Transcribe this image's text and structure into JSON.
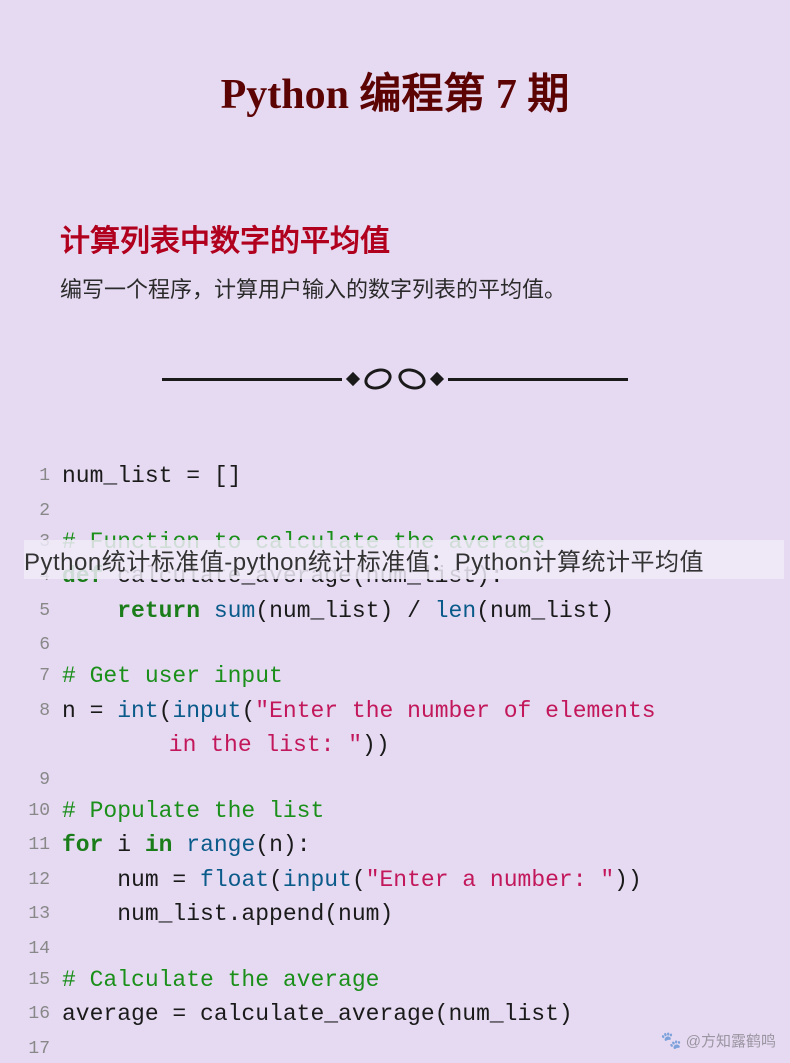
{
  "header": {
    "title": "Python 编程第 7 期"
  },
  "section": {
    "subtitle": "计算列表中数字的平均值",
    "description": "编写一个程序，计算用户输入的数字列表的平均值。"
  },
  "code": {
    "lines": [
      {
        "n": "1",
        "segments": [
          {
            "t": "num_list = []",
            "c": ""
          }
        ]
      },
      {
        "n": "2",
        "segments": []
      },
      {
        "n": "3",
        "segments": [
          {
            "t": "# Function to calculate the average",
            "c": "cmt"
          }
        ]
      },
      {
        "n": "4",
        "segments": [
          {
            "t": "def",
            "c": "kw"
          },
          {
            "t": " calculate_average(num_list):",
            "c": ""
          }
        ]
      },
      {
        "n": "5",
        "segments": [
          {
            "t": "    ",
            "c": ""
          },
          {
            "t": "return",
            "c": "kw"
          },
          {
            "t": " ",
            "c": ""
          },
          {
            "t": "sum",
            "c": "bi"
          },
          {
            "t": "(num_list) / ",
            "c": ""
          },
          {
            "t": "len",
            "c": "bi"
          },
          {
            "t": "(num_list)",
            "c": ""
          }
        ]
      },
      {
        "n": "6",
        "segments": []
      },
      {
        "n": "7",
        "segments": [
          {
            "t": "# Get user input",
            "c": "cmt"
          }
        ]
      },
      {
        "n": "8",
        "segments": [
          {
            "t": "n = ",
            "c": ""
          },
          {
            "t": "int",
            "c": "bi"
          },
          {
            "t": "(",
            "c": ""
          },
          {
            "t": "input",
            "c": "bi"
          },
          {
            "t": "(",
            "c": ""
          },
          {
            "t": "\"Enter the number of elements",
            "c": "str"
          }
        ]
      },
      {
        "n": "",
        "wrapped": true,
        "segments": [
          {
            "t": " in the list: \"",
            "c": "str"
          },
          {
            "t": "))",
            "c": ""
          }
        ]
      },
      {
        "n": "9",
        "segments": []
      },
      {
        "n": "10",
        "segments": [
          {
            "t": "# Populate the list",
            "c": "cmt"
          }
        ]
      },
      {
        "n": "11",
        "segments": [
          {
            "t": "for",
            "c": "kw"
          },
          {
            "t": " i ",
            "c": ""
          },
          {
            "t": "in",
            "c": "kw"
          },
          {
            "t": " ",
            "c": ""
          },
          {
            "t": "range",
            "c": "bi"
          },
          {
            "t": "(n):",
            "c": ""
          }
        ]
      },
      {
        "n": "12",
        "segments": [
          {
            "t": "    num = ",
            "c": ""
          },
          {
            "t": "float",
            "c": "bi"
          },
          {
            "t": "(",
            "c": ""
          },
          {
            "t": "input",
            "c": "bi"
          },
          {
            "t": "(",
            "c": ""
          },
          {
            "t": "\"Enter a number: \"",
            "c": "str"
          },
          {
            "t": "))",
            "c": ""
          }
        ]
      },
      {
        "n": "13",
        "segments": [
          {
            "t": "    num_list.append(num)",
            "c": ""
          }
        ]
      },
      {
        "n": "14",
        "segments": []
      },
      {
        "n": "15",
        "segments": [
          {
            "t": "# Calculate the average",
            "c": "cmt"
          }
        ]
      },
      {
        "n": "16",
        "segments": [
          {
            "t": "average = calculate_average(num_list)",
            "c": ""
          }
        ]
      },
      {
        "n": "17",
        "segments": []
      }
    ]
  },
  "overlay": {
    "text": "Python统计标准值-python统计标准值：Python计算统计平均值"
  },
  "watermark": {
    "text": "@方知露鹤鸣"
  }
}
